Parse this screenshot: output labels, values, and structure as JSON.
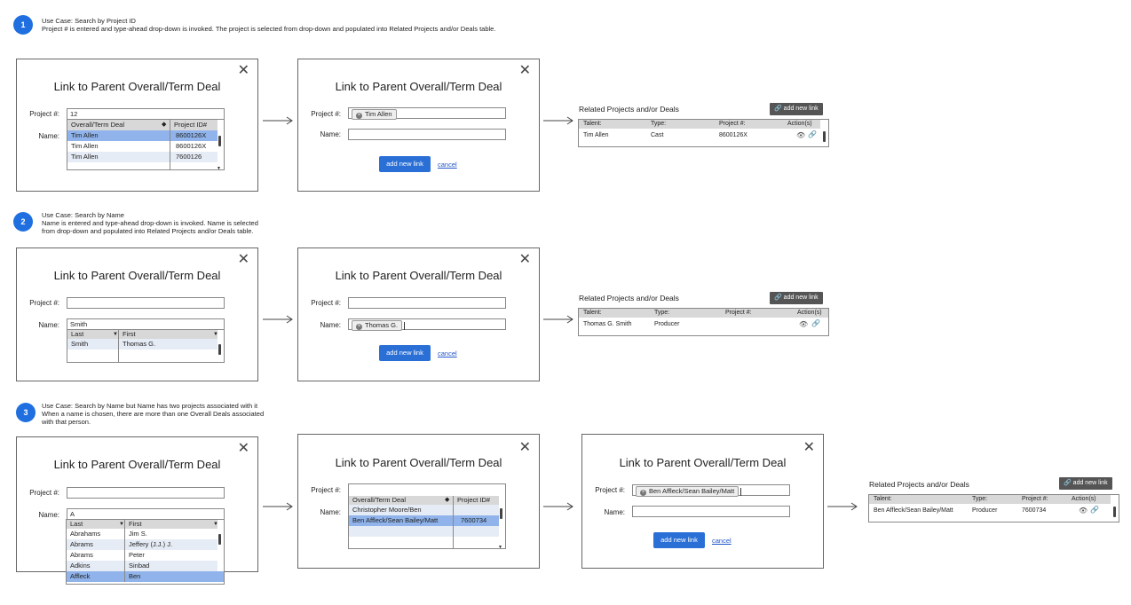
{
  "dialog_title": "Link to Parent Overall/Term Deal",
  "close_glyph": "✕",
  "labels": {
    "project": "Project #:",
    "name": "Name:"
  },
  "buttons": {
    "add_new_link": "add new link",
    "cancel": "cancel",
    "add_link_gray": "add new link"
  },
  "related_title": "Related Projects and/or Deals",
  "related_headers": {
    "talent": "Talent:",
    "type": "Type:",
    "project": "Project #:",
    "actions": "Action(s)"
  },
  "use_cases": [
    {
      "number": "1",
      "title": "Use Case: Search by Project ID",
      "description": "Project # is entered and type-ahead drop-down is invoked.  The project is selected from drop-down and populated into Related Projects and/or Deals table.",
      "d1": {
        "project_value": "12",
        "dd_headers": [
          "Overall/Term Deal",
          "Project ID#"
        ],
        "dd_rows": [
          {
            "c1": "Tim Allen",
            "c2": "8600126X"
          },
          {
            "c1": "Tim Allen",
            "c2": "8600126X"
          },
          {
            "c1": "Tim Allen",
            "c2": "7600126"
          }
        ]
      },
      "d2": {
        "chip": "Tim Allen"
      },
      "related_row": {
        "talent": "Tim Allen",
        "type": "Cast",
        "project": "8600126X"
      }
    },
    {
      "number": "2",
      "title": "Use Case: Search by Name",
      "description_l1": "Name is entered and type-ahead drop-down is invoked.  Name is selected",
      "description_l2": "from drop-down and populated into Related Projects and/or Deals table.",
      "d1": {
        "name_value": "Smith",
        "dd_headers": [
          "Last",
          "First"
        ],
        "dd_rows": [
          {
            "c1": "Smith",
            "c2": "Thomas G."
          }
        ]
      },
      "d2": {
        "chip": "Thomas G."
      },
      "related_row": {
        "talent": "Thomas G. Smith",
        "type": "Producer",
        "project": ""
      }
    },
    {
      "number": "3",
      "title": "Use Case:  Search by Name but Name has two projects associated with it",
      "description_l1": "When a name is chosen, there are more than one Overall Deals associated",
      "description_l2": "with that person.",
      "d1": {
        "name_value": "A",
        "dd_headers": [
          "Last",
          "First"
        ],
        "dd_rows": [
          {
            "c1": "Abrahams",
            "c2": "Jim S."
          },
          {
            "c1": "Abrams",
            "c2": "Jeffery (J.J.) J."
          },
          {
            "c1": "Abrams",
            "c2": "Peter"
          },
          {
            "c1": "Adkins",
            "c2": "Sinbad"
          },
          {
            "c1": "Affleck",
            "c2": "Ben"
          }
        ]
      },
      "d2": {
        "dd_headers": [
          "Overall/Term Deal",
          "Project ID#"
        ],
        "dd_rows": [
          {
            "c1": "Christopher Moore/Ben",
            "c2": ""
          },
          {
            "c1": "Ben Affleck/Sean Bailey/Matt",
            "c2": "7600734"
          }
        ]
      },
      "d3": {
        "chip": "Ben Affleck/Sean Bailey/Matt"
      },
      "related_row": {
        "talent": "Ben Affleck/Sean Bailey/Matt",
        "type": "Producer",
        "project": "7600734"
      }
    }
  ]
}
